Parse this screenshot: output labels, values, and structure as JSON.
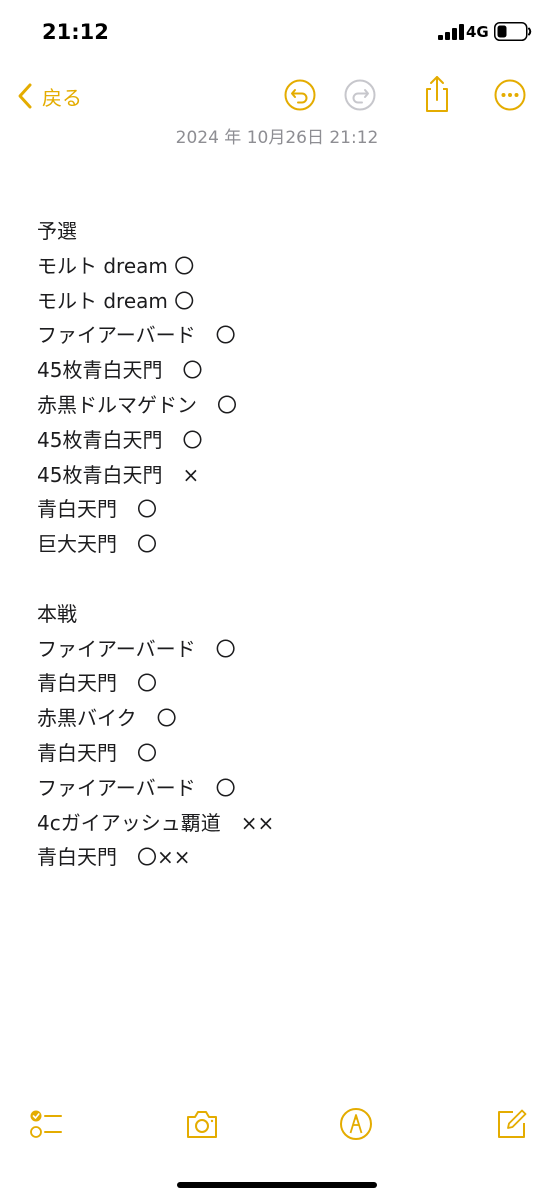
{
  "status_bar": {
    "time": "21:12",
    "network": "4G",
    "icons": [
      "signal-icon",
      "battery-icon"
    ]
  },
  "nav": {
    "back_label": "戻る",
    "icons": [
      "back-chevron-icon",
      "undo-icon",
      "redo-icon",
      "share-icon",
      "more-icon"
    ]
  },
  "note": {
    "date": "2024 年 10月26日 21:12",
    "lines": [
      "予選",
      "モルト dream 〇",
      "モルト dream 〇",
      "ファイアーバード　〇",
      "45枚青白天門　〇",
      "赤黒ドルマゲドン　〇",
      "45枚青白天門　〇",
      "45枚青白天門　×",
      "青白天門　〇",
      "巨大天門　〇",
      "",
      "本戦",
      "ファイアーバード　〇",
      "青白天門　〇",
      "赤黒バイク　〇",
      "青白天門　〇",
      "ファイアーバード　〇",
      "4cガイアッシュ覇道　××",
      "青白天門　〇××"
    ]
  },
  "toolbar": {
    "icons": [
      "checklist-icon",
      "camera-icon",
      "markup-icon",
      "compose-icon"
    ]
  },
  "colors": {
    "accent": "#e4ac00",
    "date_gray": "#8e8e93",
    "text": "#1c1c1e",
    "redo_disabled": "#c7c7cc"
  }
}
